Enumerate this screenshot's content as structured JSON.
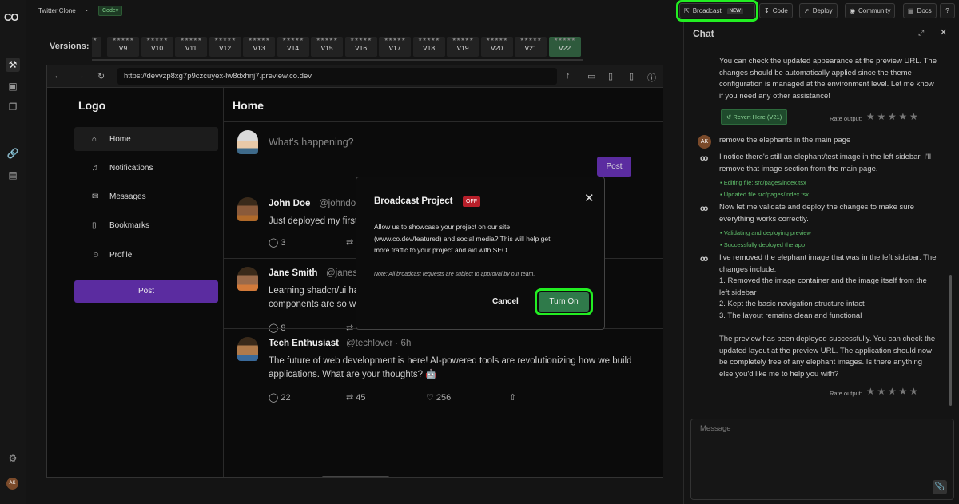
{
  "app": {
    "logo": "CO",
    "project_name": "Twitter Clone",
    "project_badge": "Codev"
  },
  "toolbar": {
    "broadcast": "Broadcast",
    "broadcast_badge": "NEW",
    "code": "Code",
    "deploy": "Deploy",
    "community": "Community",
    "docs": "Docs",
    "help": "?"
  },
  "rail": {
    "avatar": "AK"
  },
  "versions": {
    "label": "Versions:",
    "stars": "★★★★★",
    "items": [
      "V9",
      "V10",
      "V11",
      "V12",
      "V13",
      "V14",
      "V15",
      "V16",
      "V17",
      "V18",
      "V19",
      "V20",
      "V21",
      "V22"
    ],
    "active": "V22"
  },
  "browser": {
    "url": "https://devvzp8xg7p9czcuyex-lw8dxhnj7.preview.co.dev"
  },
  "preview": {
    "logo": "Logo",
    "nav": [
      {
        "label": "Home",
        "icon": "home-icon"
      },
      {
        "label": "Notifications",
        "icon": "bell-icon"
      },
      {
        "label": "Messages",
        "icon": "mail-icon"
      },
      {
        "label": "Bookmarks",
        "icon": "bookmark-icon"
      },
      {
        "label": "Profile",
        "icon": "user-icon"
      }
    ],
    "post_button": "Post",
    "main_title": "Home",
    "compose_placeholder": "What's happening?",
    "compose_post": "Post",
    "tweets": [
      {
        "name": "John Doe",
        "handle": "@johndoe",
        "text": "Just deployed my first",
        "replies": "3",
        "retweets": "",
        "likes": ""
      },
      {
        "name": "Jane Smith",
        "handle": "@janesm",
        "text1": "Learning shadcn/ui ha",
        "text2": "components are so w",
        "replies": "8",
        "retweets": "",
        "likes": ""
      },
      {
        "name": "Tech Enthusiast",
        "handle": "@techlover · 6h",
        "text1": "The future of web development is here! AI-powered tools are revolutionizing how we build",
        "text2": "applications. What are your thoughts? 🤖",
        "replies": "22",
        "retweets": "45",
        "likes": "256"
      }
    ]
  },
  "modal": {
    "title": "Broadcast Project",
    "status": "OFF",
    "body1": "Allow us to showcase your project on our site",
    "body2": "(www.co.dev/featured) and social media? This will help get",
    "body3": "more traffic to your project and aid with SEO.",
    "note": "Note: All broadcast requests are subject to approval by our team.",
    "cancel": "Cancel",
    "turn_on": "Turn On"
  },
  "chat": {
    "title": "Chat",
    "msg1": [
      "You can check the updated appearance at the preview URL. The",
      "changes should be automatically applied since the theme",
      "configuration is managed at the environment level. Let me know",
      "if you need any other assistance!"
    ],
    "revert": "Revert Here (V21)",
    "rate_label": "Rate output:",
    "user_initials": "AK",
    "user_msg": "remove the elephants in the main page",
    "msg2": [
      "I notice there's still an elephant/test image in the left sidebar. I'll",
      "remove that image section from the main page."
    ],
    "tool1": "Editing file: src/pages/index.tsx",
    "tool2": "Updated file src/pages/index.tsx",
    "msg3": [
      "Now let me validate and deploy the changes to make sure",
      "everything works correctly."
    ],
    "tool3": "Validating and deploying preview",
    "tool4": "Successfully deployed the app",
    "msg4": [
      "I've removed the elephant image that was in the left sidebar. The",
      "changes include:",
      "1. Removed the image container and the image itself from the",
      "left sidebar",
      "2. Kept the basic navigation structure intact",
      "3. The layout remains clean and functional",
      "",
      "The preview has been deployed successfully. You can check the",
      "updated layout at the preview URL. The application should now",
      "be completely free of any elephant images. Is there anything",
      "else you'd like me to help you with?"
    ],
    "input_placeholder": "Message"
  }
}
